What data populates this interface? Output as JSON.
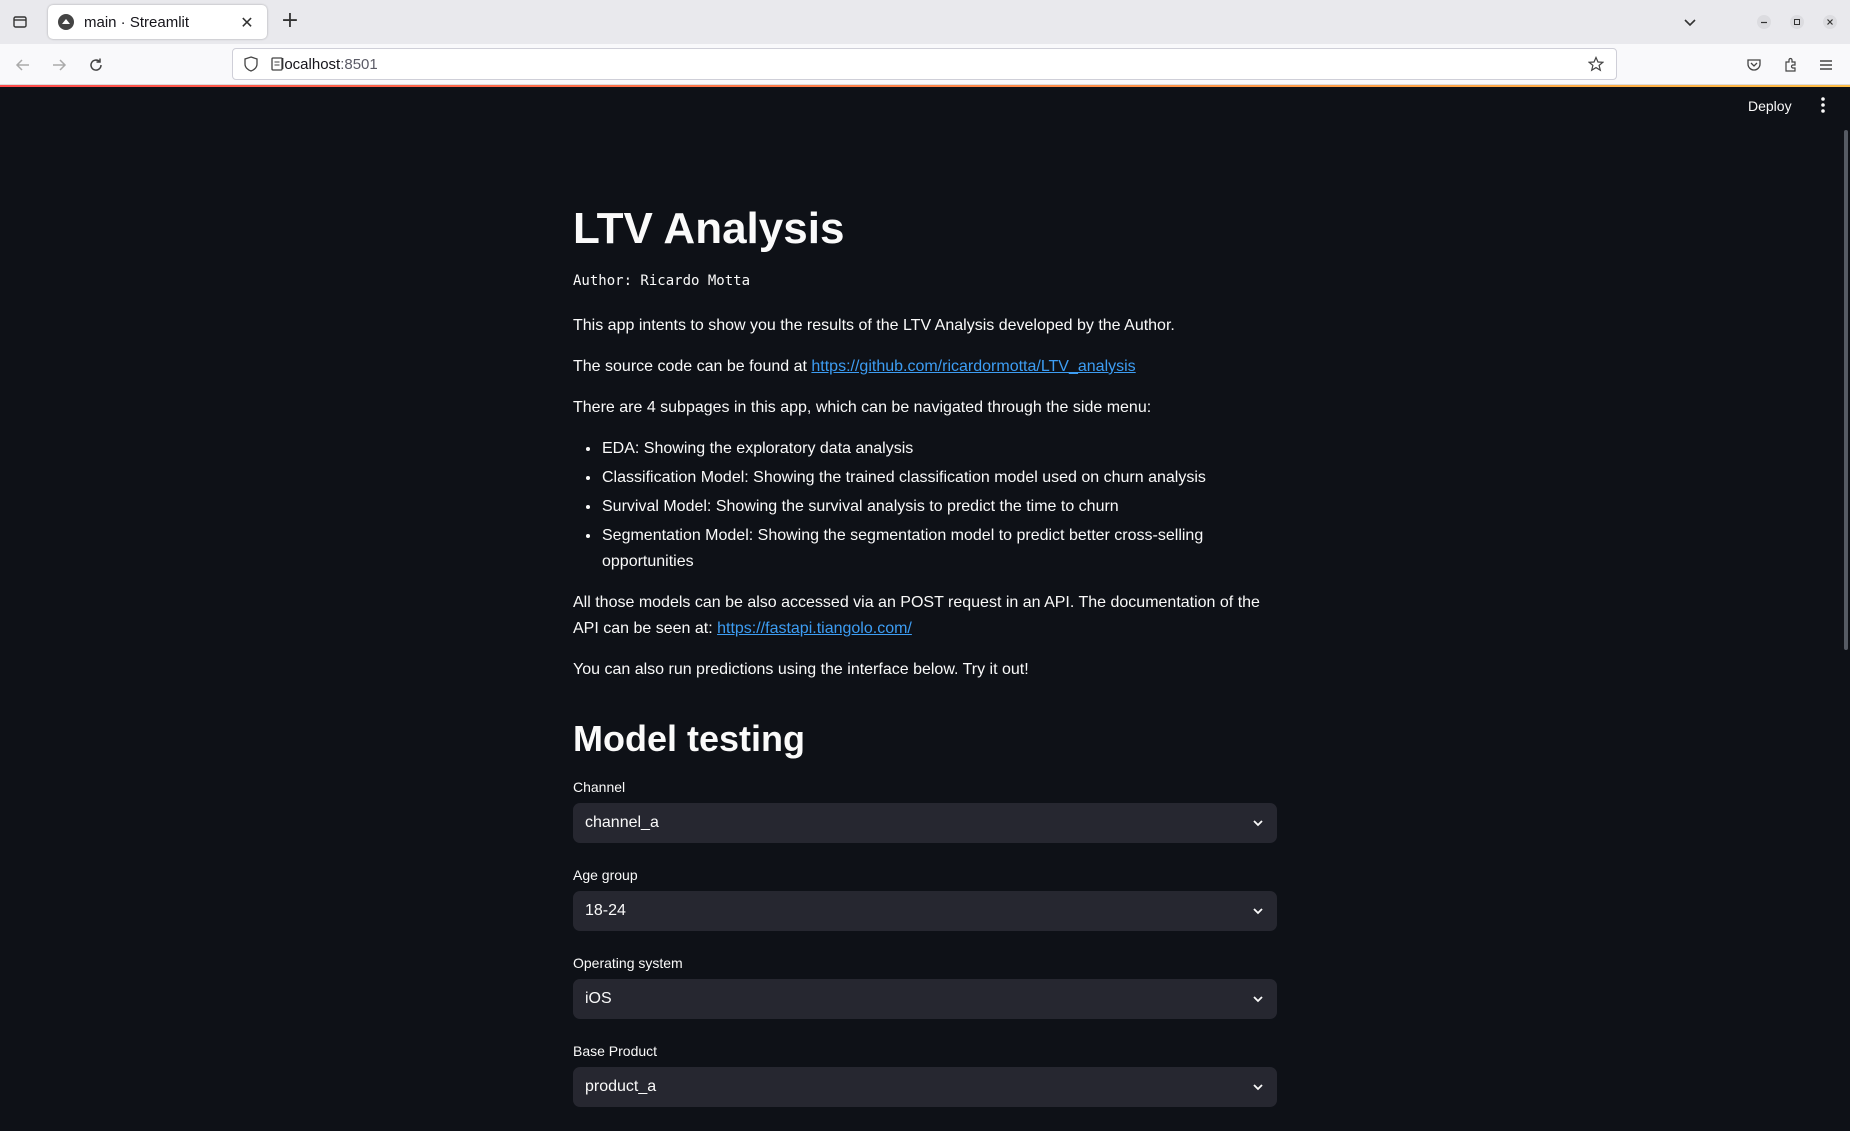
{
  "browser": {
    "tab_title": "main · Streamlit",
    "url_host": "localhost",
    "url_port": ":8501"
  },
  "header": {
    "deploy_label": "Deploy"
  },
  "main": {
    "title": "LTV Analysis",
    "author": "Author: Ricardo Motta",
    "intro": "This app intents to show you the results of the LTV Analysis developed by the Author.",
    "source_prefix": "The source code can be found at ",
    "source_link": "https://github.com/ricardormotta/LTV_analysis",
    "subpages_intro": "There are 4 subpages in this app, which can be navigated through the side menu:",
    "subpages": [
      "EDA: Showing the exploratory data analysis",
      "Classification Model: Showing the trained classification model used on churn analysis",
      "Survival Model: Showing the survival analysis to predict the time to churn",
      "Segmentation Model: Showing the segmentation model to predict better cross-selling opportunities"
    ],
    "api_text": "All those models can be also accessed via an POST request in an API. The documentation of the API can be seen at: ",
    "api_link": "https://fastapi.tiangolo.com/",
    "try_text": "You can also run predictions using the interface below. Try it out!",
    "model_testing_heading": "Model testing",
    "fields": [
      {
        "label": "Channel",
        "value": "channel_a"
      },
      {
        "label": "Age group",
        "value": "18-24"
      },
      {
        "label": "Operating system",
        "value": "iOS"
      },
      {
        "label": "Base Product",
        "value": "product_a"
      }
    ]
  }
}
